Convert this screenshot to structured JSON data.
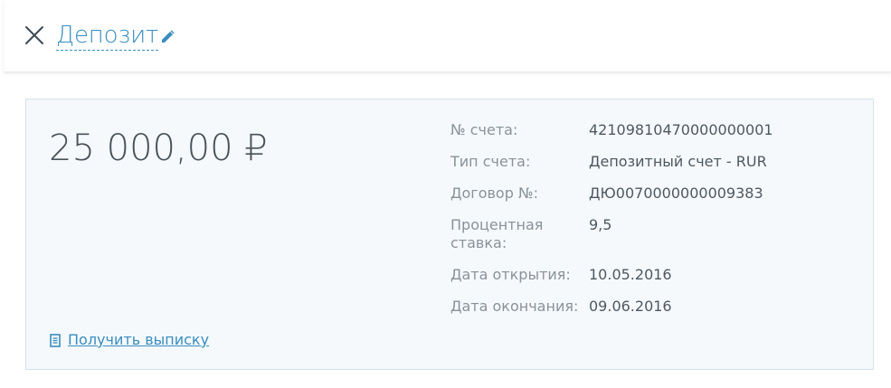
{
  "header": {
    "title": "Депозит",
    "close_icon": "close-icon",
    "edit_icon": "pencil-icon"
  },
  "card": {
    "amount": "25 000,00  ₽",
    "details": [
      {
        "label": "№ счета:",
        "value": "42109810470000000001"
      },
      {
        "label": "Тип счета:",
        "value": "Депозитный счет - RUR"
      },
      {
        "label": "Договор №:",
        "value": "ДЮ0070000000009383"
      },
      {
        "label": "Процентная ставка:",
        "value": "9,5"
      },
      {
        "label": "Дата открытия:",
        "value": "10.05.2016"
      },
      {
        "label": "Дата окончания:",
        "value": "09.06.2016"
      }
    ],
    "statement_link": "Получить выписку",
    "statement_icon": "document-icon"
  },
  "colors": {
    "accent": "#3a8dbf",
    "card_bg": "#f5f9fc",
    "card_border": "#d6e2ea",
    "label": "#8a9299",
    "value": "#4f5860"
  }
}
